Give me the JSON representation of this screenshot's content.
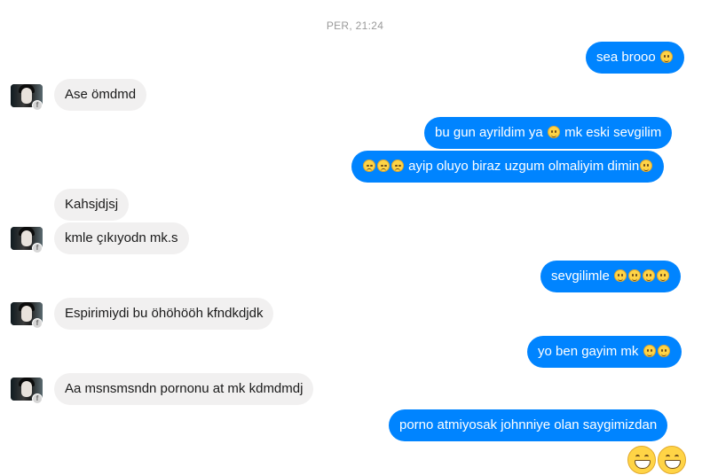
{
  "timestamp": "PER, 21:24",
  "messages": [
    {
      "id": "m1",
      "text": "sea brooo"
    },
    {
      "id": "m2",
      "text": "Ase ömdmd"
    },
    {
      "id": "m3a",
      "text": "bu gun ayrildim ya"
    },
    {
      "id": "m3b",
      "text": "mk eski sevgilim"
    },
    {
      "id": "m4",
      "text": "ayip oluyo biraz uzgum olmaliyim dimin"
    },
    {
      "id": "m5",
      "text": "Kahsjdjsj"
    },
    {
      "id": "m6",
      "text": "kmle çıkıyodn mk.s"
    },
    {
      "id": "m7",
      "text": "sevgilimle"
    },
    {
      "id": "m8",
      "text": "Espirimiydi bu öhöhööh kfndkdjdk"
    },
    {
      "id": "m9",
      "text": "yo ben gayim mk"
    },
    {
      "id": "m10",
      "text": "Aa msnsmsndn pornonu at mk kdmdmdj"
    },
    {
      "id": "m11",
      "text": "porno atmiyosak johnniye olan saygimizdan"
    }
  ],
  "icons": {
    "smile": "smiling-face-emoji",
    "sad": "disappointed-face-emoji",
    "grin": "grinning-face-emoji",
    "badge": "facebook-badge-icon"
  },
  "colors": {
    "outgoing": "#0084ff",
    "incoming": "#f1f0f0",
    "timestamp": "#9a9a9a"
  }
}
